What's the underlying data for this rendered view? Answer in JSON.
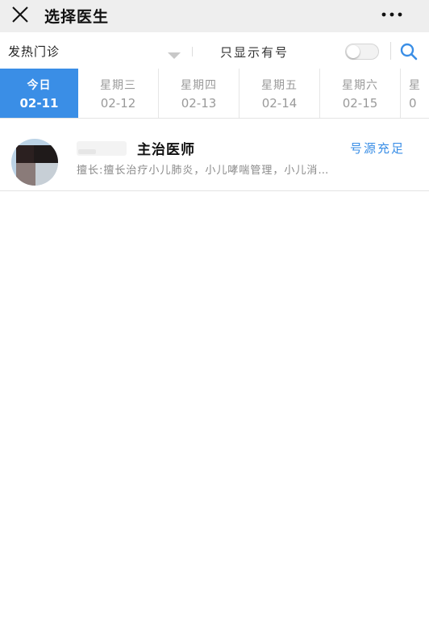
{
  "header": {
    "title": "选择医生",
    "close_icon": "close-icon",
    "more_icon": "more-dots-icon"
  },
  "filter": {
    "department": "发热门诊",
    "only_available_label": "只显示有号",
    "only_available_on": false,
    "search_icon": "search-icon"
  },
  "dates": [
    {
      "weekday": "今日",
      "date": "02-11",
      "selected": true
    },
    {
      "weekday": "星期三",
      "date": "02-12",
      "selected": false
    },
    {
      "weekday": "星期四",
      "date": "02-13",
      "selected": false
    },
    {
      "weekday": "星期五",
      "date": "02-14",
      "selected": false
    },
    {
      "weekday": "星期六",
      "date": "02-15",
      "selected": false
    },
    {
      "weekday": "星",
      "date": "0",
      "selected": false
    }
  ],
  "doctors": [
    {
      "title": "主治医师",
      "status": "号源充足",
      "specialty": "擅长:擅长治疗小儿肺炎，小儿哮喘管理，小儿消…"
    }
  ],
  "colors": {
    "accent": "#3a8ee6",
    "header_bg": "#eeeeee"
  }
}
